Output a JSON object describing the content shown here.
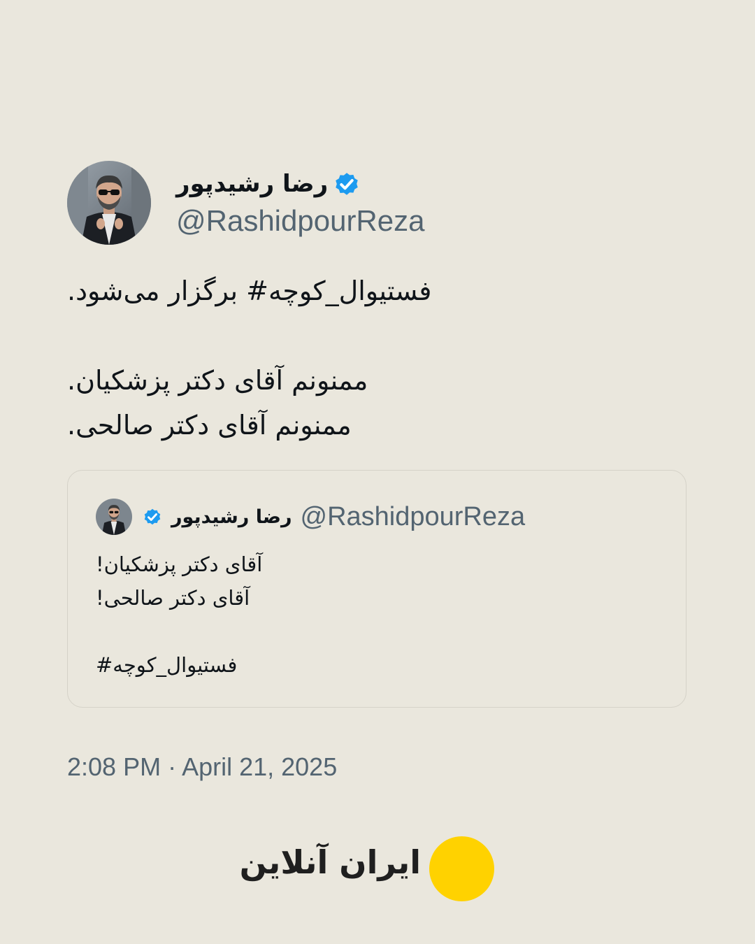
{
  "tweet": {
    "author": {
      "display_name": "رضا رشیدپور",
      "handle": "@RashidpourReza",
      "verified_icon": "verified-badge-icon",
      "avatar": "profile-photo"
    },
    "body_lines": [
      "فستیوال_کوچه# برگزار می‌شود.",
      "",
      "ممنونم آقای دکتر پزشکیان.",
      "ممنونم آقای دکتر صالحی."
    ],
    "timestamp": "2:08 PM · April 21, 2025"
  },
  "quoted_tweet": {
    "author": {
      "display_name": "رضا رشیدپور",
      "handle": "@RashidpourReza",
      "verified_icon": "verified-badge-icon"
    },
    "body_lines": [
      "آقای دکتر پزشکیان!",
      "آقای دکتر صالحی!",
      "",
      "فستیوال_کوچه#"
    ]
  },
  "brand": {
    "name": "ایران آنلاین",
    "logo_color": "#ffd200"
  },
  "colors": {
    "background": "#eae7dd",
    "text": "#0f1419",
    "secondary_text": "#536471",
    "verified": "#1d9bf0",
    "card_border": "#d5d2c8"
  }
}
